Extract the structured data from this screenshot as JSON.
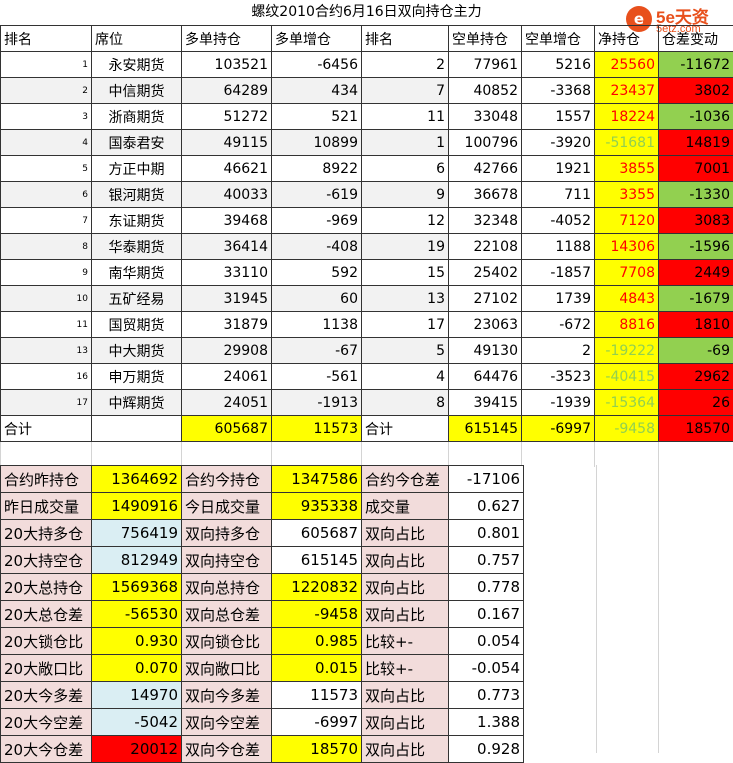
{
  "title": "螺纹2010合约6月16日双向持仓主力",
  "logo": {
    "mark": "e",
    "text": "5e天资",
    "url": "5etz.com"
  },
  "headers": [
    "排名",
    "席位",
    "多单持仓",
    "多单增仓",
    "排名",
    "空单持仓",
    "空单增仓",
    "净持仓",
    "仓差变动"
  ],
  "rows": [
    {
      "rank": "1",
      "seat": "永安期货",
      "long": "103521",
      "long_chg": "-6456",
      "srank": "2",
      "short": "77961",
      "short_chg": "5216",
      "net": "25560",
      "net_style": "y-red",
      "diff": "-11672",
      "diff_style": "g"
    },
    {
      "rank": "2",
      "seat": "中信期货",
      "long": "64289",
      "long_chg": "434",
      "srank": "7",
      "short": "40852",
      "short_chg": "-3368",
      "net": "23437",
      "net_style": "y-red",
      "diff": "3802",
      "diff_style": "rd"
    },
    {
      "rank": "3",
      "seat": "浙商期货",
      "long": "51272",
      "long_chg": "521",
      "srank": "11",
      "short": "33048",
      "short_chg": "1557",
      "net": "18224",
      "net_style": "y-red",
      "diff": "-1036",
      "diff_style": "g"
    },
    {
      "rank": "4",
      "seat": "国泰君安",
      "long": "49115",
      "long_chg": "10899",
      "srank": "1",
      "short": "100796",
      "short_chg": "-3920",
      "net": "-51681",
      "net_style": "y-green",
      "diff": "14819",
      "diff_style": "rd"
    },
    {
      "rank": "5",
      "seat": "方正中期",
      "long": "46621",
      "long_chg": "8922",
      "srank": "6",
      "short": "42766",
      "short_chg": "1921",
      "net": "3855",
      "net_style": "y-red",
      "diff": "7001",
      "diff_style": "rd"
    },
    {
      "rank": "6",
      "seat": "银河期货",
      "long": "40033",
      "long_chg": "-619",
      "srank": "9",
      "short": "36678",
      "short_chg": "711",
      "net": "3355",
      "net_style": "y-red",
      "diff": "-1330",
      "diff_style": "g"
    },
    {
      "rank": "7",
      "seat": "东证期货",
      "long": "39468",
      "long_chg": "-969",
      "srank": "12",
      "short": "32348",
      "short_chg": "-4052",
      "net": "7120",
      "net_style": "y-red",
      "diff": "3083",
      "diff_style": "rd"
    },
    {
      "rank": "8",
      "seat": "华泰期货",
      "long": "36414",
      "long_chg": "-408",
      "srank": "19",
      "short": "22108",
      "short_chg": "1188",
      "net": "14306",
      "net_style": "y-red",
      "diff": "-1596",
      "diff_style": "g"
    },
    {
      "rank": "9",
      "seat": "南华期货",
      "long": "33110",
      "long_chg": "592",
      "srank": "15",
      "short": "25402",
      "short_chg": "-1857",
      "net": "7708",
      "net_style": "y-red",
      "diff": "2449",
      "diff_style": "rd"
    },
    {
      "rank": "10",
      "seat": "五矿经易",
      "long": "31945",
      "long_chg": "60",
      "srank": "13",
      "short": "27102",
      "short_chg": "1739",
      "net": "4843",
      "net_style": "y-red",
      "diff": "-1679",
      "diff_style": "g"
    },
    {
      "rank": "11",
      "seat": "国贸期货",
      "long": "31879",
      "long_chg": "1138",
      "srank": "17",
      "short": "23063",
      "short_chg": "-672",
      "net": "8816",
      "net_style": "y-red",
      "diff": "1810",
      "diff_style": "rd"
    },
    {
      "rank": "13",
      "seat": "中大期货",
      "long": "29908",
      "long_chg": "-67",
      "srank": "5",
      "short": "49130",
      "short_chg": "2",
      "net": "-19222",
      "net_style": "y-green",
      "diff": "-69",
      "diff_style": "g"
    },
    {
      "rank": "16",
      "seat": "申万期货",
      "long": "24061",
      "long_chg": "-561",
      "srank": "4",
      "short": "64476",
      "short_chg": "-3523",
      "net": "-40415",
      "net_style": "y-green",
      "diff": "2962",
      "diff_style": "rd"
    },
    {
      "rank": "17",
      "seat": "中辉期货",
      "long": "24051",
      "long_chg": "-1913",
      "srank": "8",
      "short": "39415",
      "short_chg": "-1939",
      "net": "-15364",
      "net_style": "y-green",
      "diff": "26",
      "diff_style": "rd"
    }
  ],
  "total": {
    "label": "合计",
    "long": "605687",
    "long_chg": "11573",
    "label2": "合计",
    "short": "615145",
    "short_chg": "-6997",
    "net": "-9458",
    "diff": "18570"
  },
  "summary": [
    {
      "l1": "合约昨持仓",
      "v1": "1364692",
      "s1": "y",
      "l2": "合约今持仓",
      "v2": "1347586",
      "s2": "y",
      "l3": "合约今仓差",
      "v3": "-17106"
    },
    {
      "l1": "昨日成交量",
      "v1": "1490916",
      "s1": "y",
      "l2": "今日成交量",
      "v2": "935338",
      "s2": "y",
      "l3": "成交量",
      "v3": "0.627"
    },
    {
      "l1": "20大持多仓",
      "v1": "756419",
      "s1": "bl",
      "l2": "双向持多仓",
      "v2": "605687",
      "s2": "wh",
      "l3": "双向占比",
      "v3": "0.801"
    },
    {
      "l1": "20大持空仓",
      "v1": "812949",
      "s1": "bl",
      "l2": "双向持空仓",
      "v2": "615145",
      "s2": "wh",
      "l3": "双向占比",
      "v3": "0.757"
    },
    {
      "l1": "20大总持仓",
      "v1": "1569368",
      "s1": "y",
      "l2": "双向总持仓",
      "v2": "1220832",
      "s2": "y",
      "l3": "双向占比",
      "v3": "0.778"
    },
    {
      "l1": "20大总仓差",
      "v1": "-56530",
      "s1": "y",
      "l2": "双向总仓差",
      "v2": "-9458",
      "s2": "y",
      "l3": "双向占比",
      "v3": "0.167"
    },
    {
      "l1": "20大锁仓比",
      "v1": "0.930",
      "s1": "y",
      "l2": "双向锁仓比",
      "v2": "0.985",
      "s2": "y",
      "l3": "比较+-",
      "v3": "0.054"
    },
    {
      "l1": "20大敞口比",
      "v1": "0.070",
      "s1": "y",
      "l2": "双向敞口比",
      "v2": "0.015",
      "s2": "y",
      "l3": "比较+-",
      "v3": "-0.054"
    },
    {
      "l1": "20大今多差",
      "v1": "14970",
      "s1": "bl",
      "l2": "双向今多差",
      "v2": "11573",
      "s2": "wh",
      "l3": "双向占比",
      "v3": "0.773"
    },
    {
      "l1": "20大今空差",
      "v1": "-5042",
      "s1": "bl",
      "l2": "双向今空差",
      "v2": "-6997",
      "s2": "wh",
      "l3": "双向占比",
      "v3": "1.388"
    },
    {
      "l1": "20大今仓差",
      "v1": "20012",
      "s1": "rd",
      "l2": "双向今仓差",
      "v2": "18570",
      "s2": "y",
      "l3": "双向占比",
      "v3": "0.928"
    }
  ]
}
